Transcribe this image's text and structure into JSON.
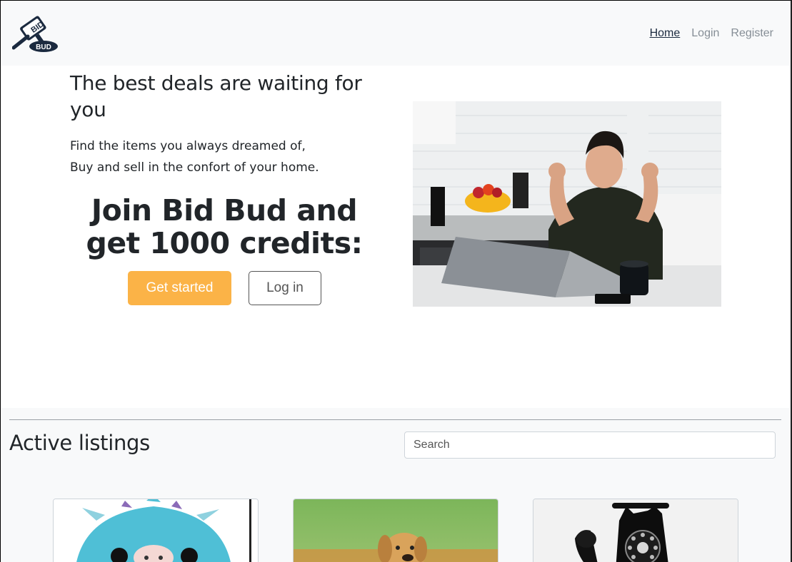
{
  "brand": {
    "logo_top": "BID",
    "logo_bottom": "BUD"
  },
  "nav": {
    "items": [
      {
        "label": "Home"
      },
      {
        "label": "Login"
      },
      {
        "label": "Register"
      }
    ]
  },
  "hero": {
    "heading": "The best deals are waiting for you",
    "line1": "Find the items you always dreamed of,",
    "line2": "Buy and sell in the confort of your home.",
    "join": "Join Bid Bud and get 1000 credits:",
    "get_started": "Get started",
    "log_in": "Log in"
  },
  "listings": {
    "title": "Active listings",
    "search_placeholder": "Search",
    "cards": [
      {
        "icon": "plush-dragon-image"
      },
      {
        "icon": "puppy-image"
      },
      {
        "icon": "rotary-telephone-image"
      }
    ]
  },
  "colors": {
    "accent": "#fbb347",
    "navy": "#1b2a3f",
    "nav_muted": "#868e96"
  }
}
